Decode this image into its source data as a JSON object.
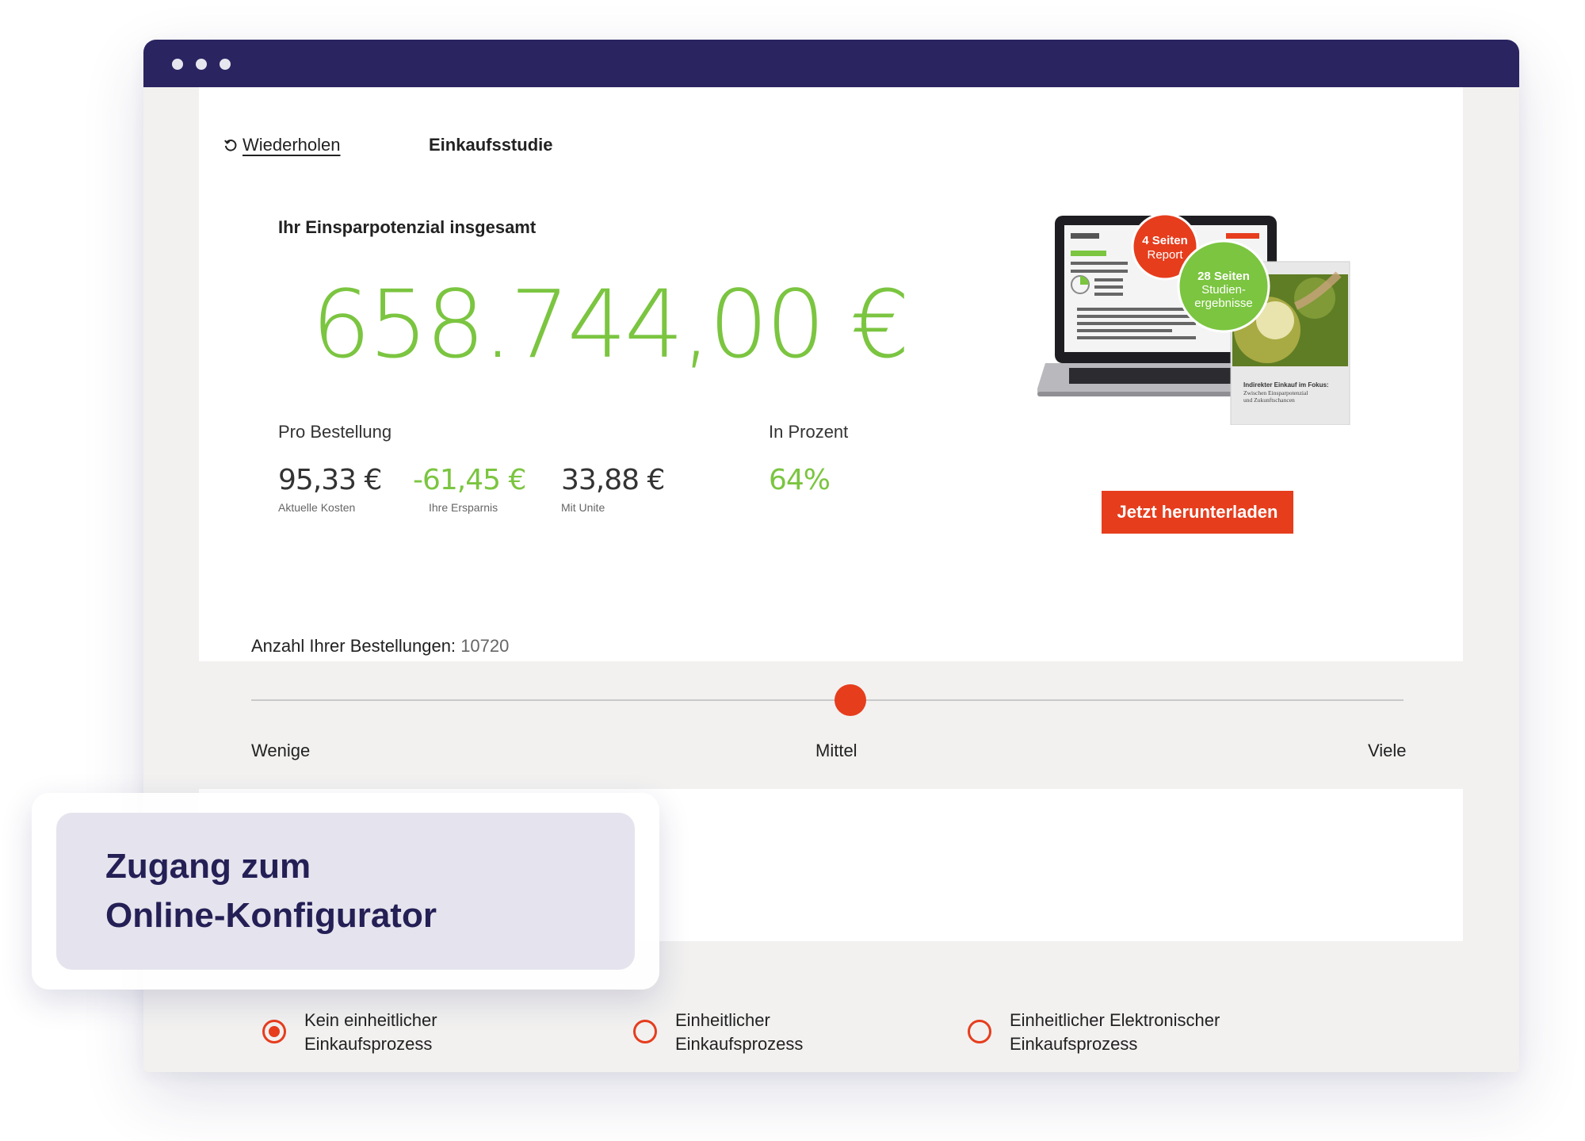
{
  "header": {
    "retry_label": "Wiederholen",
    "title": "Einkaufsstudie"
  },
  "summary": {
    "total_label": "Ihr Einsparpotenzial insgesamt",
    "total_value": "658.744,00 €",
    "per_order_label": "Pro Bestellung",
    "percent_label": "In Prozent",
    "stats": [
      {
        "value": "95,33 €",
        "caption": "Aktuelle Kosten"
      },
      {
        "value": "-61,45 €",
        "caption": "Ihre Ersparnis"
      },
      {
        "value": "33,88 €",
        "caption": "Mit Unite"
      }
    ],
    "percent_value": "64%"
  },
  "promo": {
    "badge_red_line1": "4 Seiten",
    "badge_red_line2": "Report",
    "badge_green_line1": "28 Seiten",
    "badge_green_line2": "Studien-",
    "badge_green_line3": "ergebnisse",
    "cover_line1": "Indirekter Einkauf im Fokus:",
    "cover_line2": "Zwischen Einsparpotenzial",
    "cover_line3": "und Zukunftschancen",
    "cta_label": "Jetzt herunterladen"
  },
  "orders": {
    "label": "Anzahl Ihrer Bestellungen:",
    "value": "10720",
    "slider_fraction": 0.52,
    "scale_low": "Wenige",
    "scale_mid": "Mittel",
    "scale_high": "Viele"
  },
  "process": {
    "options": [
      {
        "line1": "Kein einheitlicher",
        "line2": "Einkaufsprozess",
        "checked": true
      },
      {
        "line1": "Einheitlicher",
        "line2": "Einkaufsprozess",
        "checked": false
      },
      {
        "line1": "Einheitlicher Elektronischer",
        "line2": "Einkaufsprozess",
        "checked": false
      }
    ]
  },
  "overlay": {
    "line1": "Zugang zum",
    "line2": "Online-Konfigurator"
  },
  "colors": {
    "titlebar": "#2a2460",
    "accent": "#e63d1d",
    "green": "#7bc540",
    "overlay_text": "#241f55"
  }
}
